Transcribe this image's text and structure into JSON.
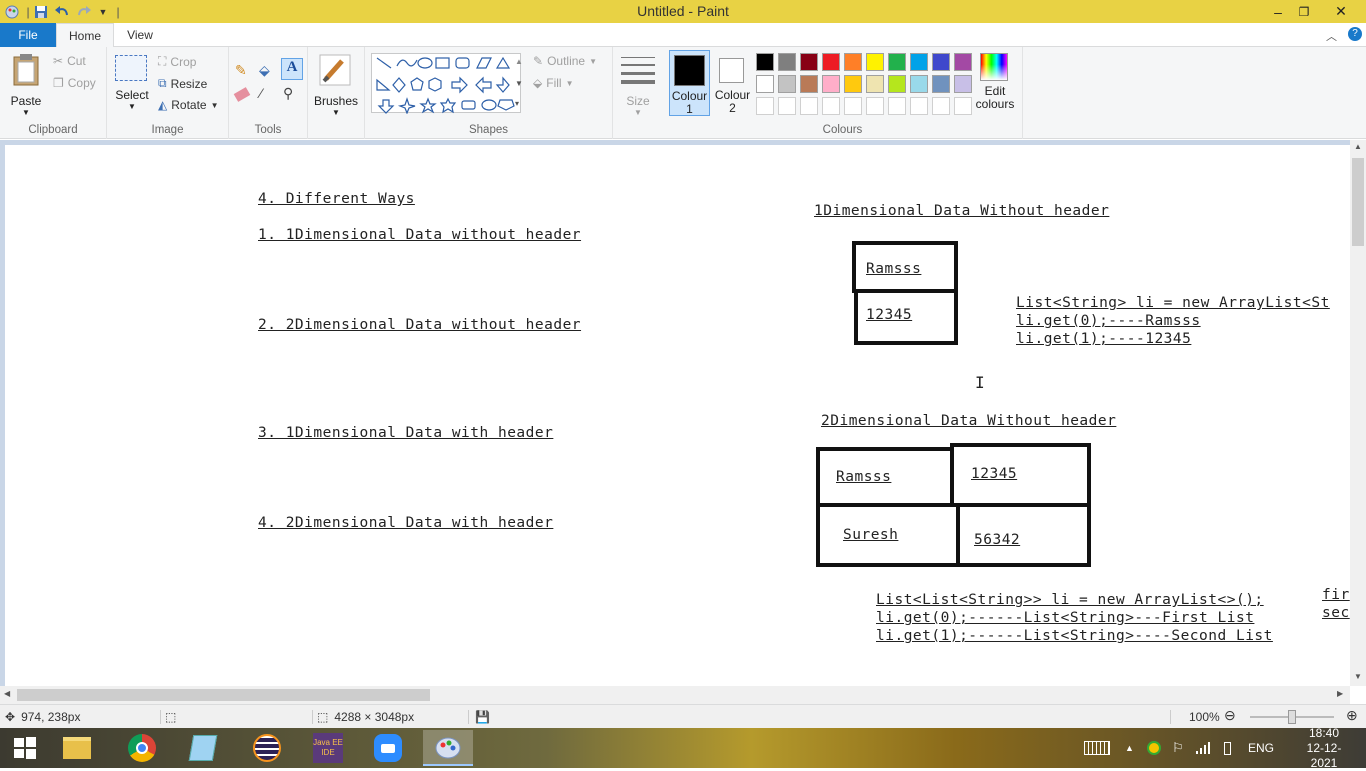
{
  "titlebar": {
    "title": "Untitled - Paint",
    "minimize": "–",
    "maximize": "❐",
    "close": "✕"
  },
  "tabs": {
    "file": "File",
    "home": "Home",
    "view": "View"
  },
  "ribbon": {
    "clipboard": {
      "label": "Clipboard",
      "paste": "Paste",
      "cut": "Cut",
      "copy": "Copy"
    },
    "image": {
      "label": "Image",
      "select": "Select",
      "crop": "Crop",
      "resize": "Resize",
      "rotate": "Rotate"
    },
    "tools": {
      "label": "Tools"
    },
    "brushes": {
      "label": "Brushes"
    },
    "shapes": {
      "label": "Shapes",
      "outline": "Outline",
      "fill": "Fill"
    },
    "size": {
      "label": "Size"
    },
    "colours": {
      "label": "Colours",
      "colour1": "Colour\n1",
      "colour2": "Colour\n2",
      "colour1_l1": "Colour",
      "colour1_l2": "1",
      "colour2_l1": "Colour",
      "colour2_l2": "2",
      "edit_l1": "Edit",
      "edit_l2": "colours",
      "palette_row1": [
        "#000000",
        "#7f7f7f",
        "#880015",
        "#ed1c24",
        "#ff7f27",
        "#fff200",
        "#22b14c",
        "#00a2e8",
        "#3f48cc",
        "#a349a4"
      ],
      "palette_row2": [
        "#ffffff",
        "#c3c3c3",
        "#b97a57",
        "#ffaec9",
        "#ffc90e",
        "#efe4b0",
        "#b5e61d",
        "#99d9ea",
        "#7092be",
        "#c8bfe7"
      ]
    }
  },
  "canvas": {
    "left_list": [
      "4. Different Ways",
      "1. 1Dimensional Data without header",
      "2. 2Dimensional Data without header",
      "3. 1Dimensional Data with header",
      "4. 2Dimensional Data with header"
    ],
    "one_d_title": "1Dimensional Data Without header",
    "one_d_cells": [
      "Ramsss",
      "12345"
    ],
    "one_d_code": [
      "List<String> li = new ArrayList<St",
      "li.get(0);----Ramsss",
      "li.get(1);----12345"
    ],
    "two_d_title": "2Dimensional Data Without header",
    "two_d_cells": [
      "Ramsss",
      "12345",
      "Suresh",
      "56342"
    ],
    "two_d_code": [
      " List<List<String>> li = new ArrayList<>();",
      "li.get(0);------List<String>---First List",
      "li.get(1);------List<String>----Second List"
    ],
    "edge_text": [
      "fir",
      "sec"
    ]
  },
  "status": {
    "cursor_pos": "974, 238px",
    "image_size": "4288 × 3048px",
    "zoom": "100%"
  },
  "taskbar": {
    "lang": "ENG",
    "time": "18:40",
    "date": "12-12-2021"
  }
}
